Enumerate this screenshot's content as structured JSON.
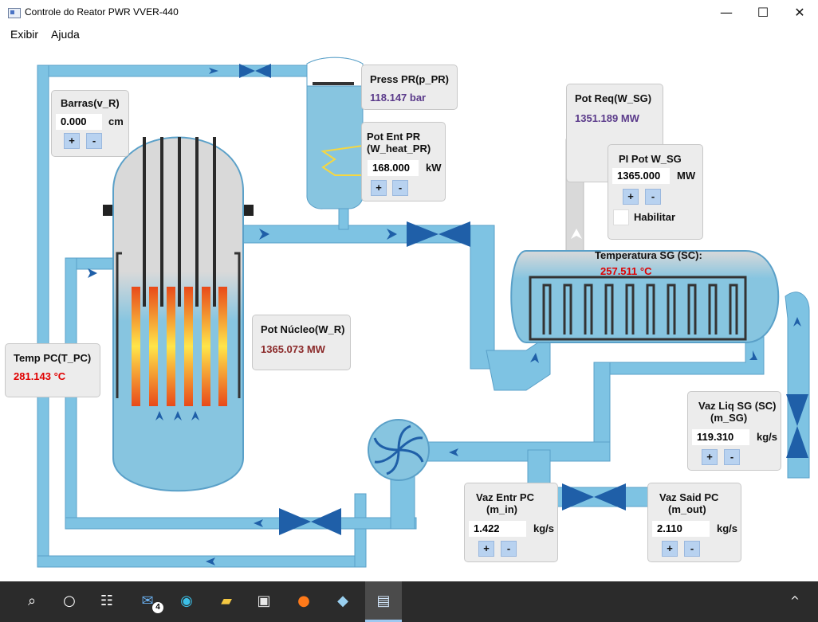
{
  "window": {
    "title": "Controle do Reator PWR VVER-440",
    "minimize_glyph": "—",
    "maximize_glyph": "☐",
    "close_glyph": "✕"
  },
  "menu": {
    "items": [
      {
        "label": "Exibir"
      },
      {
        "label": "Ajuda"
      }
    ]
  },
  "colors": {
    "pipe": "#7ec3e3",
    "pipe_border": "#5aa0c8",
    "valve": "#1f5fa8",
    "water": "#87c5e0",
    "steam": "#d9d9d9",
    "fuel_hot": "#e84a1a",
    "fuel_mid": "#ffe54a",
    "red_value": "#e00000",
    "purple_value": "#5a3a8a",
    "brown_value": "#8b2a2a"
  },
  "panels": {
    "rods": {
      "label": "Barras(v_R)",
      "value": "0.000",
      "unit": "cm",
      "plus": "+",
      "minus": "-"
    },
    "pressurizer_pressure": {
      "label": "Press PR(p_PR)",
      "value": "118.147 bar"
    },
    "pressurizer_heater": {
      "label_line1": "Pot Ent PR",
      "label_line2": "(W_heat_PR)",
      "value": "168.000",
      "unit": "kW",
      "plus": "+",
      "minus": "-"
    },
    "power_required": {
      "label": "Pot Req(W_SG)",
      "value": "1351.189 MW"
    },
    "pi_power": {
      "label": "PI Pot W_SG",
      "value": "1365.000",
      "unit": "MW",
      "plus": "+",
      "minus": "-",
      "enable_label": "Habilitar"
    },
    "sg_temperature": {
      "label": "Temperatura SG (SC):",
      "value": "257.511 °C"
    },
    "core_power": {
      "label": "Pot Núcleo(W_R)",
      "value": "1365.073 MW"
    },
    "pc_temperature": {
      "label": "Temp PC(T_PC)",
      "value": "281.143 °C"
    },
    "sg_liquid_flow": {
      "label_line1": "Vaz Liq SG (SC)",
      "label_line2": "(m_SG)",
      "value": "119.310",
      "unit": "kg/s",
      "plus": "+",
      "minus": "-"
    },
    "pc_inlet_flow": {
      "label_line1": "Vaz Entr PC",
      "label_line2": "(m_in)",
      "value": "1.422",
      "unit": "kg/s",
      "plus": "+",
      "minus": "-"
    },
    "pc_outlet_flow": {
      "label_line1": "Vaz Said PC",
      "label_line2": "(m_out)",
      "value": "2.110",
      "unit": "kg/s",
      "plus": "+",
      "minus": "-"
    }
  },
  "taskbar": {
    "icons": [
      "search-icon",
      "task-view-icon",
      "widgets-icon",
      "mail-icon",
      "edge-icon",
      "file-explorer-icon",
      "store-icon",
      "firefox-icon",
      "notes-icon",
      "reactor-app-icon"
    ],
    "mail_badge": "4",
    "tray_chevron": "^"
  }
}
